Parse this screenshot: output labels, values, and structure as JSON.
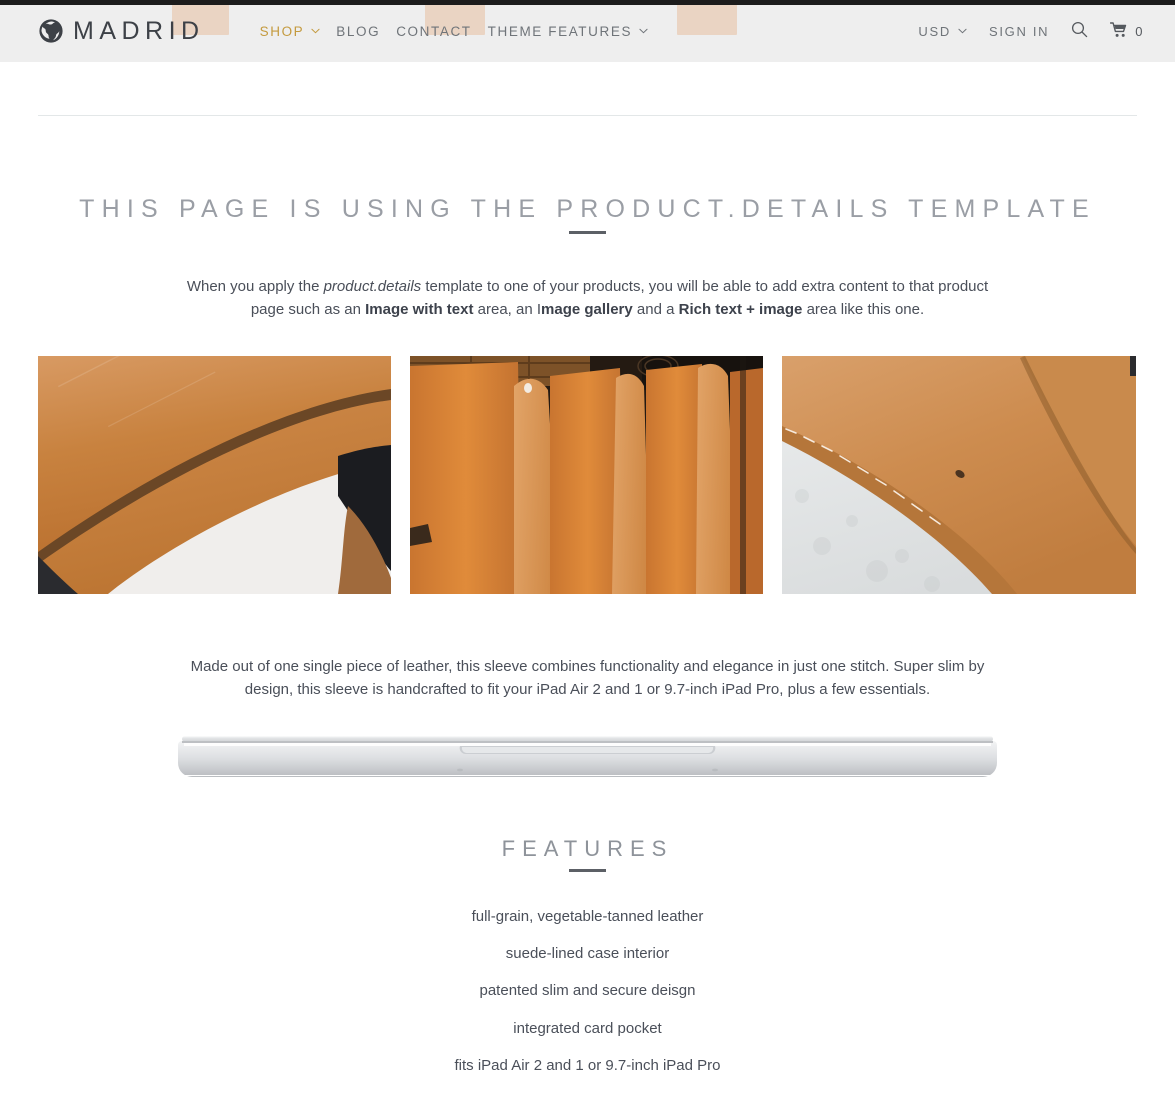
{
  "header": {
    "logo": {
      "icon": "globe-icon",
      "text": "MADRID"
    },
    "nav": [
      {
        "label": "SHOP",
        "accent": true,
        "caret": true
      },
      {
        "label": "BLOG",
        "accent": false,
        "caret": false
      },
      {
        "label": "CONTACT",
        "accent": false,
        "caret": false
      },
      {
        "label": "THEME FEATURES",
        "accent": false,
        "caret": true
      }
    ],
    "utility": {
      "currency": "USD",
      "currency_caret": "chevron-down-icon",
      "sign_in": "SIGN IN",
      "search_icon": "search-icon",
      "cart_icon": "shopping-cart-icon",
      "cart_count": "0"
    },
    "colors": {
      "accent": "#c49a3e",
      "header_bg": "#eeeeee",
      "top_strip": "#1c1c1c",
      "nav_text": "#6f7479"
    }
  },
  "main": {
    "title": "THIS PAGE IS USING THE PRODUCT.DETAILS TEMPLATE",
    "intro": {
      "part1": "When you apply the ",
      "em1": "product.details",
      "part2": " template to one of your products, you will be able to add extra content to that product page such as an ",
      "b1": "Image with text",
      "part3": " area, an I",
      "b2": "mage gallery",
      "part4": " and a ",
      "b3": "Rich text + image",
      "part5": " area like this one."
    },
    "gallery": [
      {
        "alt": "tan-leather-sleeve-closeup"
      },
      {
        "alt": "hanging-leather-hides-tannery"
      },
      {
        "alt": "stitched-leather-corner-on-white"
      }
    ],
    "description": "Made out of one single piece of leather, this sleeve combines functionality and elegance in just one stitch. Super slim by design, this sleeve is handcrafted to fit your iPad Air 2 and 1 or 9.7-inch iPad Pro, plus a few essentials.",
    "laptop_image_alt": "closed-silver-laptop-front-edge",
    "features_title": "FEATURES",
    "features": [
      "full-grain, vegetable-tanned leather",
      "suede-lined case interior",
      "patented slim and secure deisgn",
      "integrated card pocket",
      "fits iPad Air 2 and 1 or 9.7-inch iPad Pro"
    ]
  }
}
